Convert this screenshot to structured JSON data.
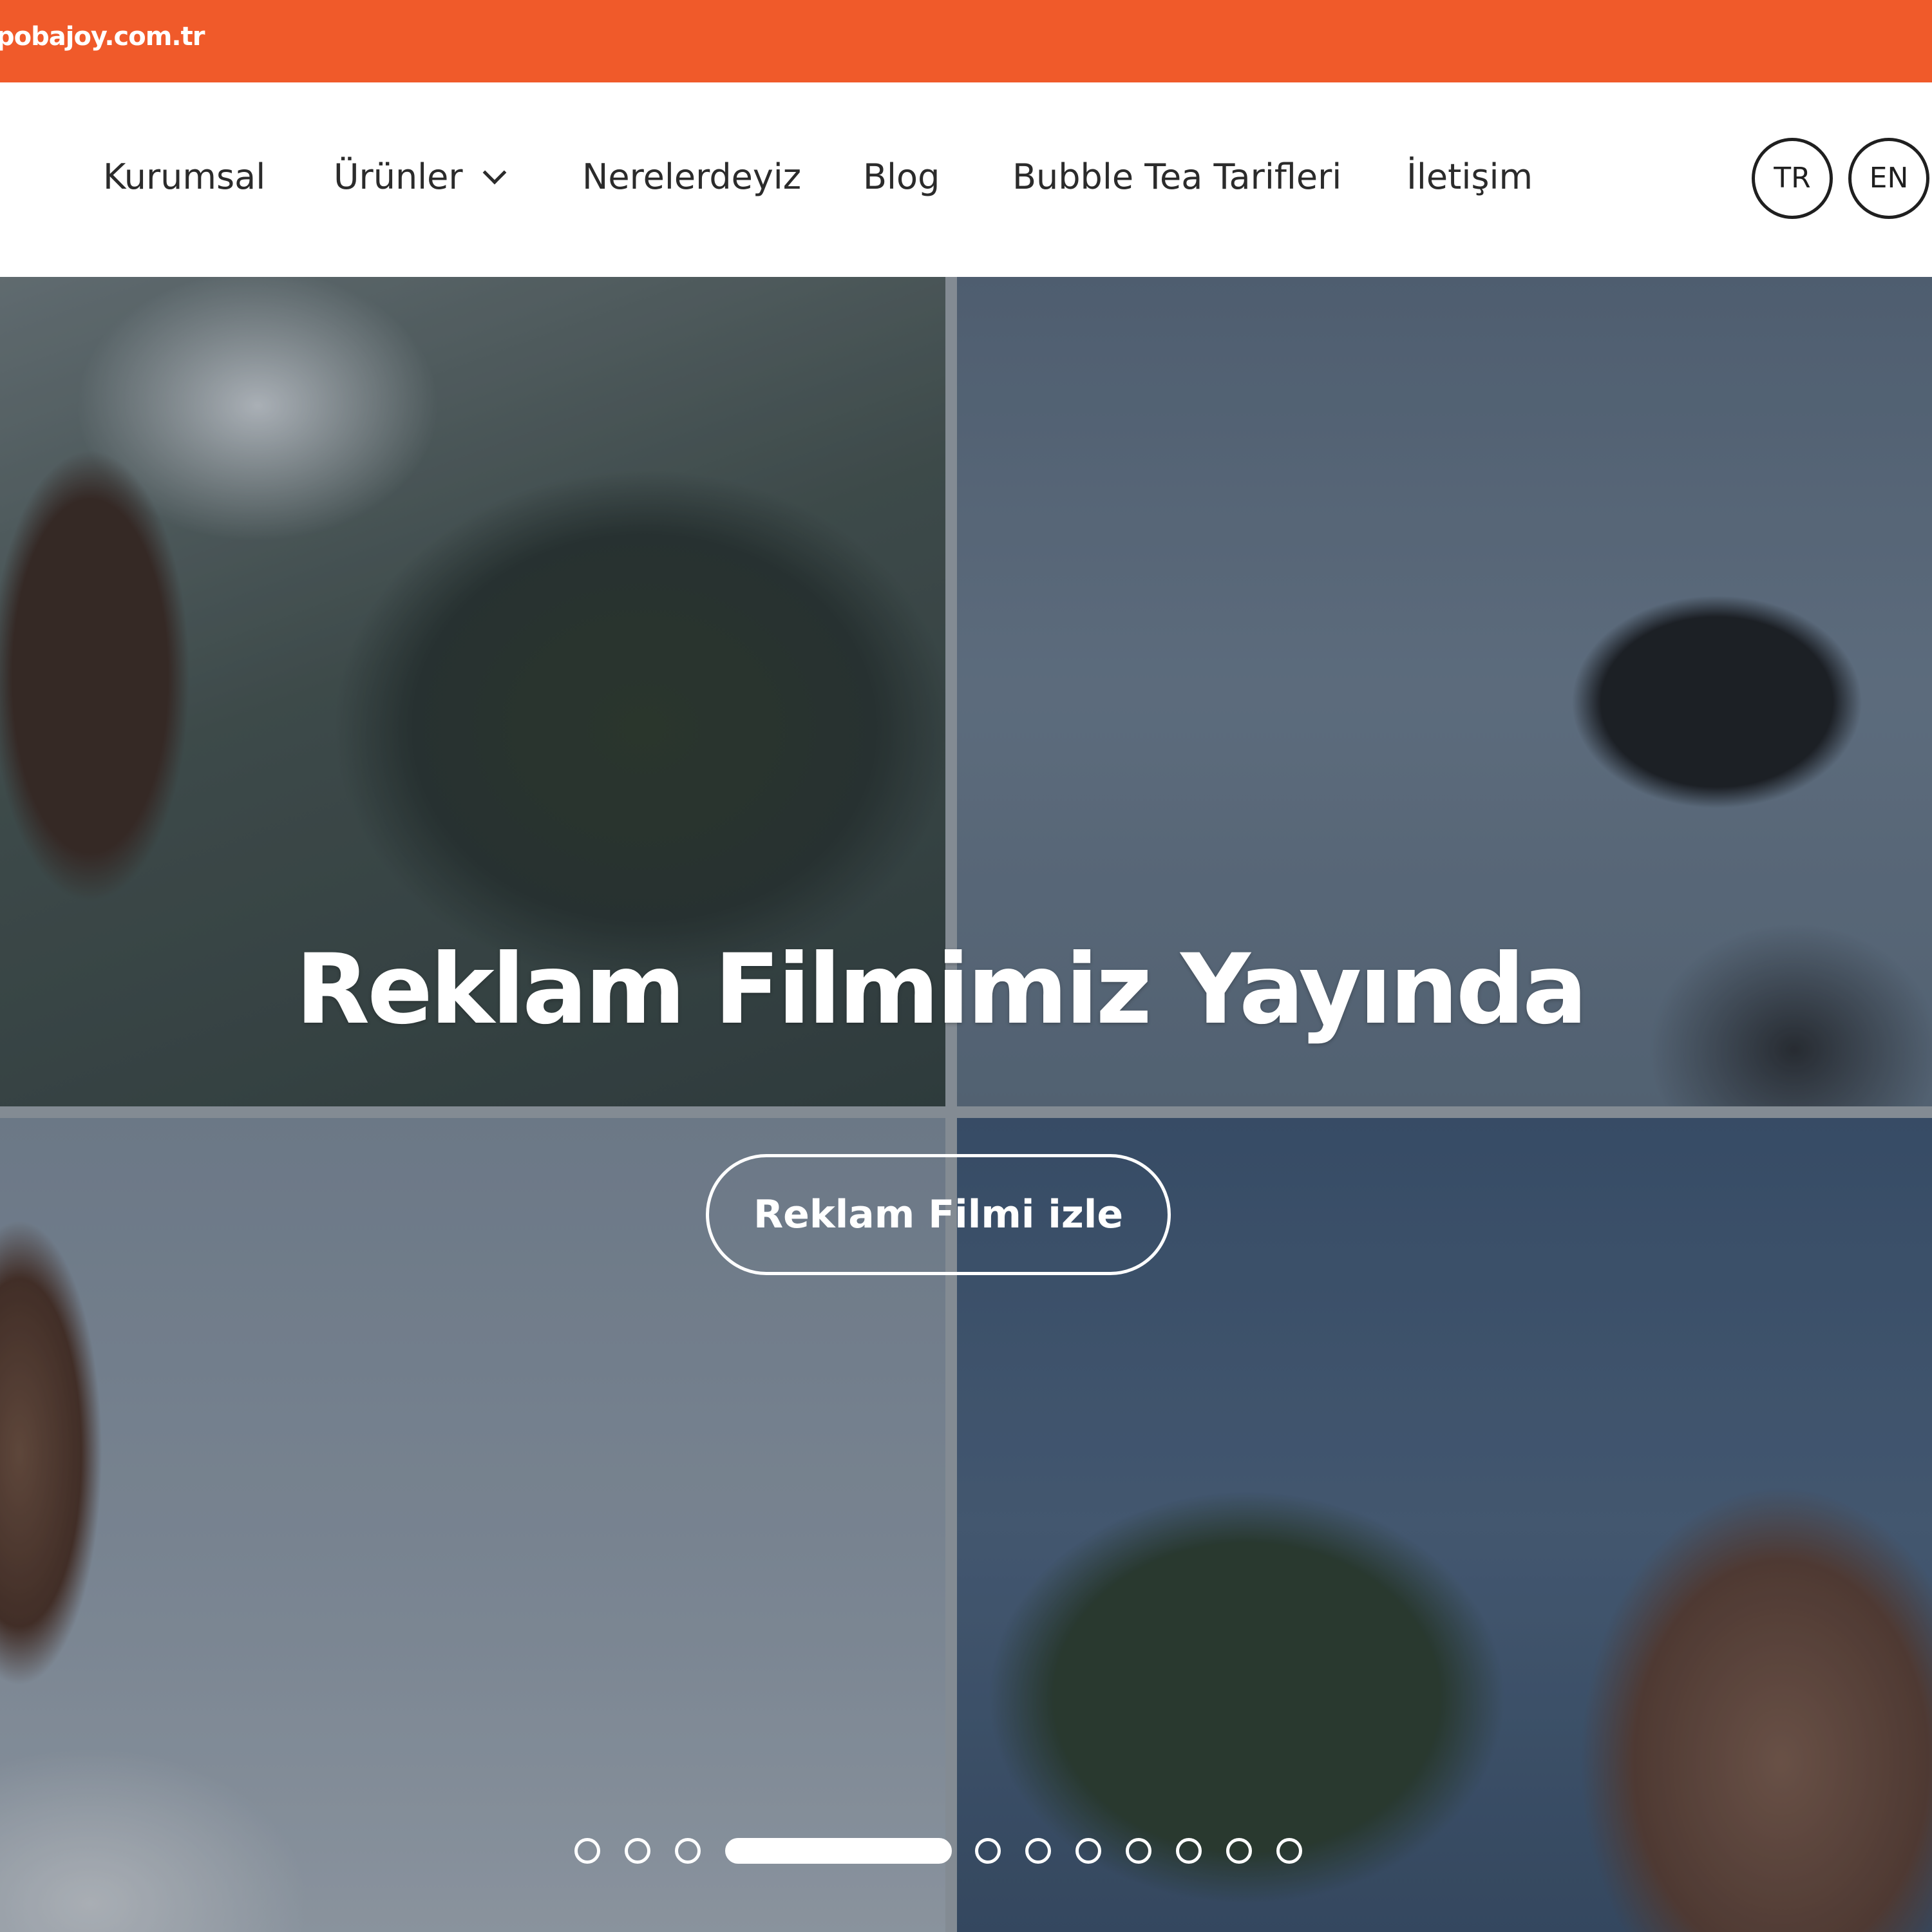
{
  "topbar": {
    "domain_text": "pobajoy.com.tr",
    "color": "#f05a2a"
  },
  "nav": {
    "items": [
      {
        "label": "Kurumsal"
      },
      {
        "label": "Ürünler",
        "has_dropdown": true
      },
      {
        "label": "Nerelerdeyiz"
      },
      {
        "label": "Blog"
      },
      {
        "label": "Bubble Tea Tarifleri"
      },
      {
        "label": "İletişim"
      }
    ],
    "languages": [
      "TR",
      "EN"
    ]
  },
  "hero": {
    "title": "Reklam Filmimiz Yayında",
    "button_label": "Reklam Filmi izle"
  },
  "slider": {
    "dot_count": 12,
    "active_index": 3
  }
}
